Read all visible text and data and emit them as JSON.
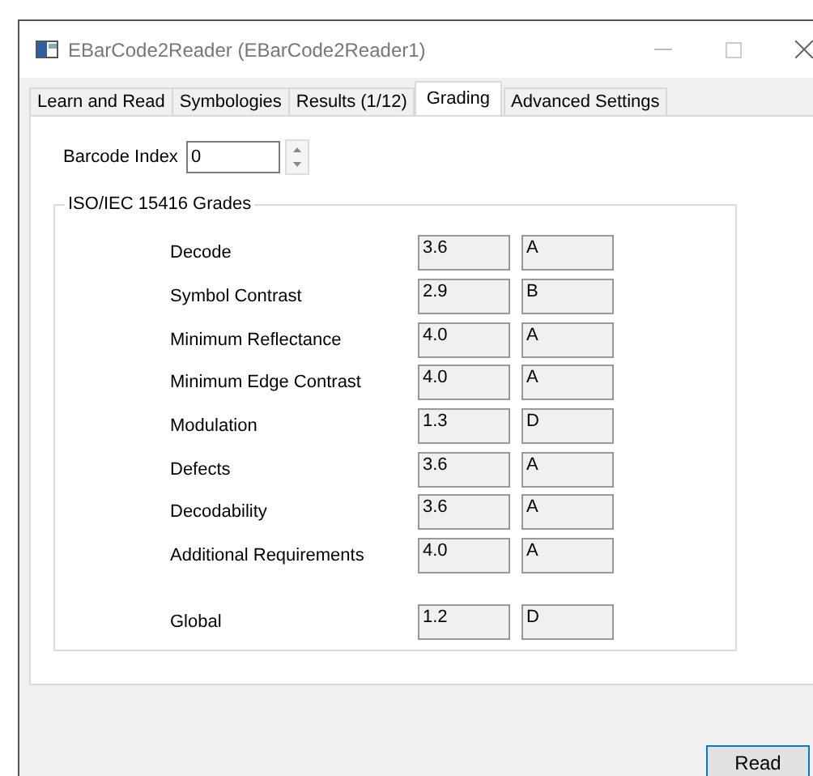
{
  "window": {
    "title": "EBarCode2Reader (EBarCode2Reader1)"
  },
  "tabs": [
    {
      "label": "Learn and Read",
      "selected": false
    },
    {
      "label": "Symbologies",
      "selected": false
    },
    {
      "label": "Results (1/12)",
      "selected": false
    },
    {
      "label": "Grading",
      "selected": true
    },
    {
      "label": "Advanced Settings",
      "selected": false
    }
  ],
  "barcode_index": {
    "label": "Barcode Index",
    "value": "0"
  },
  "grades": {
    "title": "ISO/IEC 15416 Grades",
    "rows": [
      {
        "name": "Decode",
        "value": "3.6",
        "grade": "A"
      },
      {
        "name": "Symbol Contrast",
        "value": "2.9",
        "grade": "B"
      },
      {
        "name": "Minimum Reflectance",
        "value": "4.0",
        "grade": "A"
      },
      {
        "name": "Minimum Edge Contrast",
        "value": "4.0",
        "grade": "A"
      },
      {
        "name": "Modulation",
        "value": "1.3",
        "grade": "D"
      },
      {
        "name": "Defects",
        "value": "3.6",
        "grade": "A"
      },
      {
        "name": "Decodability",
        "value": "3.6",
        "grade": "A"
      },
      {
        "name": "Additional Requirements",
        "value": "4.0",
        "grade": "A"
      }
    ],
    "global": {
      "name": "Global",
      "value": "1.2",
      "grade": "D"
    }
  },
  "buttons": [
    {
      "label": "Read"
    }
  ]
}
